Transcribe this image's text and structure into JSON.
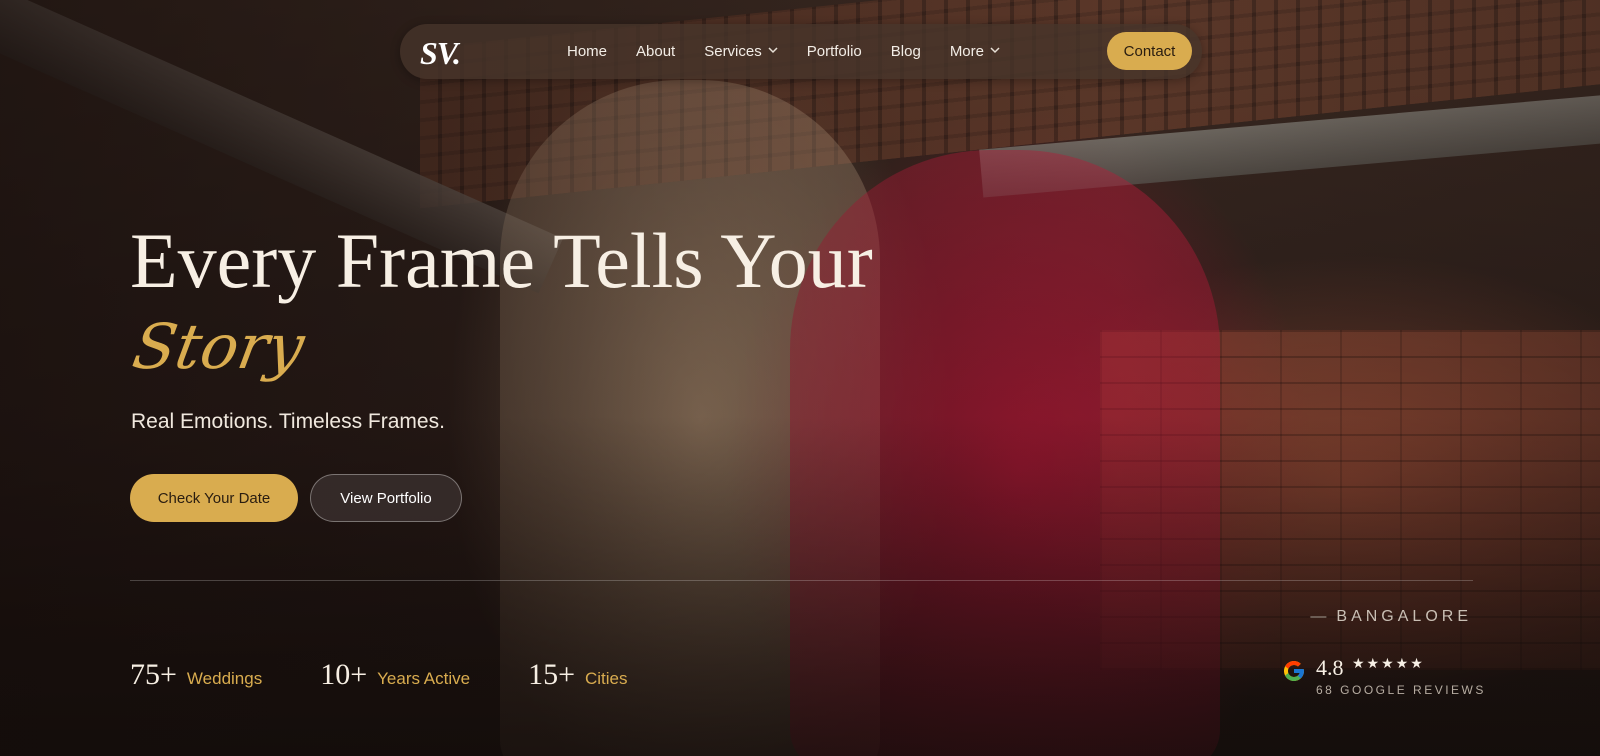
{
  "nav": {
    "logo": "SV.",
    "items": [
      {
        "label": "Home",
        "dropdown": false
      },
      {
        "label": "About",
        "dropdown": false
      },
      {
        "label": "Services",
        "dropdown": true
      },
      {
        "label": "Portfolio",
        "dropdown": false
      },
      {
        "label": "Blog",
        "dropdown": false
      },
      {
        "label": "More",
        "dropdown": true
      }
    ],
    "contact_label": "Contact"
  },
  "hero": {
    "title": "Every Frame Tells Your",
    "accent": "Story",
    "subtitle": "Real Emotions. Timeless Frames.",
    "primary_button": "Check Your Date",
    "secondary_button": "View Portfolio"
  },
  "stats": [
    {
      "value": "75+",
      "label": "Weddings"
    },
    {
      "value": "10+",
      "label": "Years Active"
    },
    {
      "value": "15+",
      "label": "Cities"
    }
  ],
  "location": {
    "dash": "—",
    "city": "BANGALORE"
  },
  "reviews": {
    "rating": "4.8",
    "stars": "★★★★★",
    "star_count": 5,
    "count_text": "68 GOOGLE REVIEWS",
    "icon": "google-icon"
  },
  "colors": {
    "accent": "#d9ac4f",
    "text_light": "#f7efe4",
    "nav_bg": "#46342a"
  }
}
